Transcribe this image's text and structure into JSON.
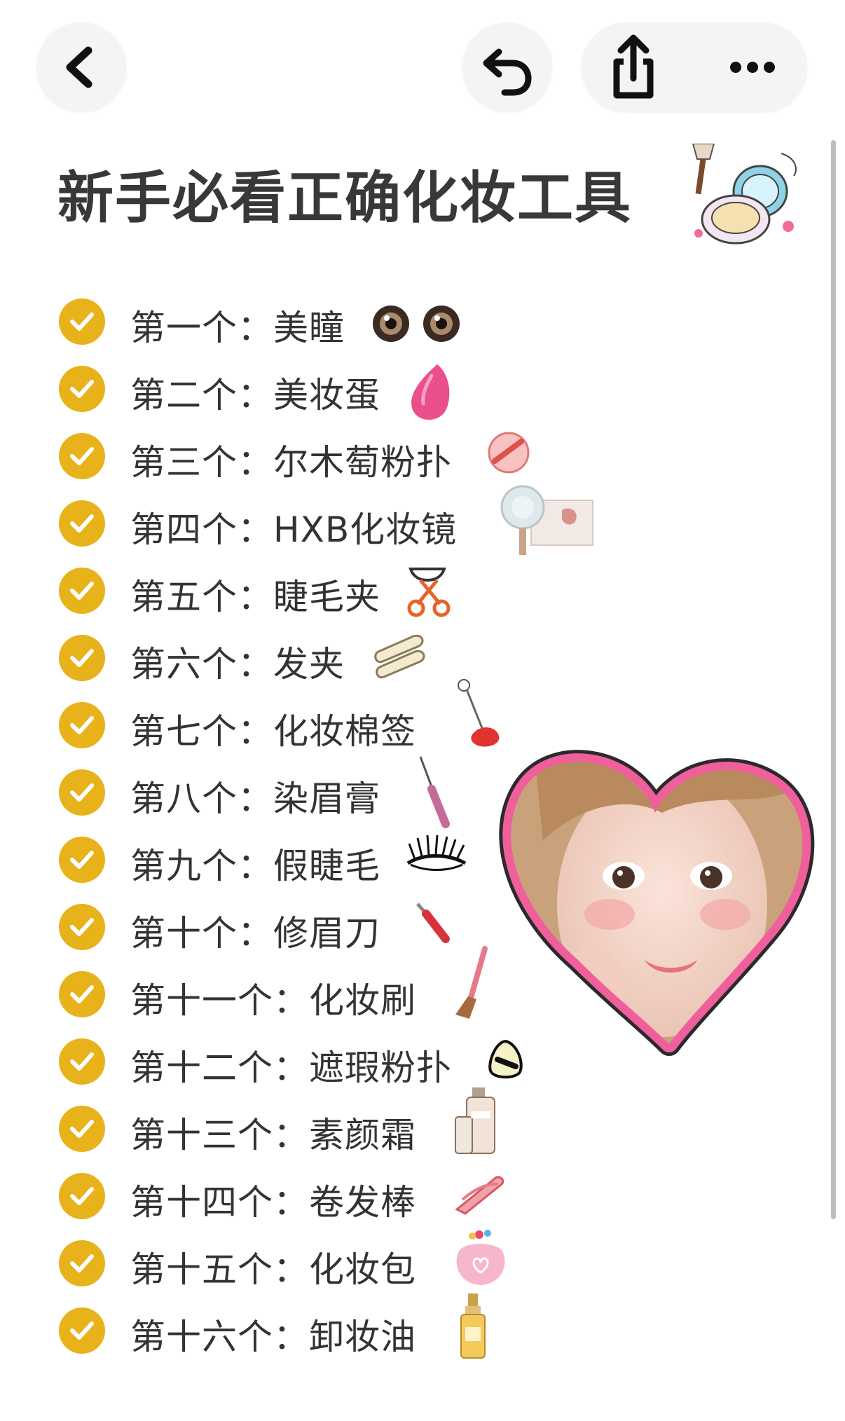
{
  "title": "新手必看正确化妆工具",
  "toolbar": {
    "back_icon": "chevron-left-icon",
    "undo_icon": "undo-icon",
    "share_icon": "share-icon",
    "more_icon": "more-icon"
  },
  "colors": {
    "check": "#e8b21b",
    "heart_border": "#ef5f9c",
    "scrollbar": "#bdbdbd"
  },
  "items": [
    {
      "label": "第一个：美瞳",
      "icon": "contact-lens-icon"
    },
    {
      "label": "第二个：美妆蛋",
      "icon": "beauty-sponge-icon"
    },
    {
      "label": "第三个：尔木萄粉扑",
      "icon": "powder-puff-icon"
    },
    {
      "label": "第四个：HXB化妆镜",
      "icon": "makeup-mirror-icon"
    },
    {
      "label": "第五个：睫毛夹",
      "icon": "eyelash-curler-icon"
    },
    {
      "label": "第六个：发夹",
      "icon": "hair-clip-icon"
    },
    {
      "label": "第七个：化妆棉签",
      "icon": "cotton-swab-icon"
    },
    {
      "label": "第八个：染眉膏",
      "icon": "brow-mascara-icon"
    },
    {
      "label": "第九个：假睫毛",
      "icon": "false-lashes-icon"
    },
    {
      "label": "第十个：修眉刀",
      "icon": "brow-razor-icon"
    },
    {
      "label": "第十一个：化妆刷",
      "icon": "makeup-brush-icon"
    },
    {
      "label": "第十二个：遮瑕粉扑",
      "icon": "concealer-puff-icon"
    },
    {
      "label": "第十三个：素颜霜",
      "icon": "cream-bottle-icon"
    },
    {
      "label": "第十四个：卷发棒",
      "icon": "curling-iron-icon"
    },
    {
      "label": "第十五个：化妆包",
      "icon": "makeup-bag-icon"
    },
    {
      "label": "第十六个：卸妆油",
      "icon": "cleansing-oil-icon"
    }
  ]
}
